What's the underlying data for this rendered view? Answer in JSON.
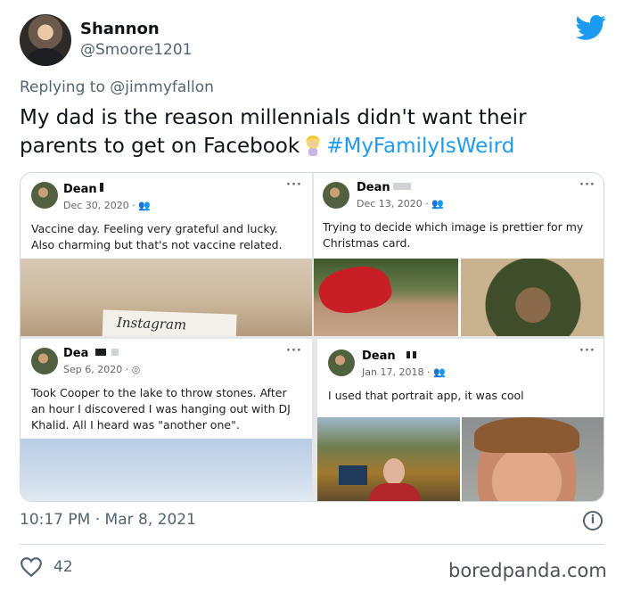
{
  "tweet": {
    "author_name": "Shannon",
    "author_handle": "@Smoore1201",
    "replying_prefix": "Replying to ",
    "replying_to": "@jimmyfallon",
    "text": "My dad is the reason millennials didn't want their parents to get on Facebook",
    "emoji": "woman-facepalming-emoji",
    "hashtag": "#MyFamilyIsWeird",
    "timestamp": "10:17 PM · Mar 8, 2021",
    "likes": "42"
  },
  "media": {
    "posts": [
      {
        "name": "Dean",
        "date": "Dec 30, 2020 · ",
        "audience_icon": "friends-icon",
        "text": "Vaccine day. Feeling very grateful and lucky. Also charming but that's not vaccine related.",
        "image_caption": "Instagram"
      },
      {
        "name": "Dean",
        "date": "Dec 13, 2020 · ",
        "audience_icon": "friends-icon",
        "text": "Trying to decide which image is prettier for my Christmas card."
      },
      {
        "name": "Dea",
        "date": "Sep 6, 2020 · ",
        "audience_icon": "globe-icon",
        "text": "Took Cooper to the lake to throw stones. After an hour I discovered I was hanging  out with DJ Khalid. All I heard was \"another one\"."
      },
      {
        "name": "Dean",
        "date": "Jan 17, 2018 · ",
        "audience_icon": "friends-icon",
        "text": "I used that portrait app, it was cool"
      }
    ],
    "more_label": "···"
  },
  "icons": {
    "brand": "twitter-bird-icon",
    "info": "info-icon",
    "like": "heart-icon"
  },
  "colors": {
    "twitter_blue": "#1d9bf0",
    "muted_text": "#536471"
  },
  "info_glyph": "i",
  "watermark": "boredpanda.com"
}
